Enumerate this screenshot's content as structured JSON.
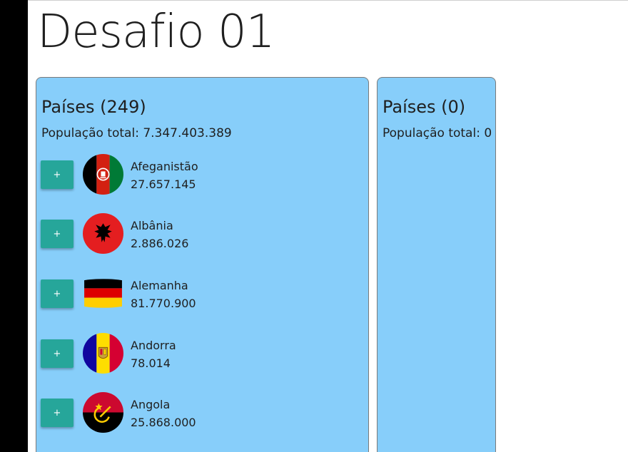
{
  "page": {
    "title": "Desafio 01"
  },
  "panel_all": {
    "title": "Países (249)",
    "population": "População total: 7.347.403.389"
  },
  "panel_selected": {
    "title": "Países (0)",
    "population": "População total: 0"
  },
  "add_button_label": "+",
  "countries": [
    {
      "name": "Afeganistão",
      "population": "27.657.145",
      "flag": "afghanistan-flag"
    },
    {
      "name": "Albânia",
      "population": "2.886.026",
      "flag": "albania-flag"
    },
    {
      "name": "Alemanha",
      "population": "81.770.900",
      "flag": "germany-flag"
    },
    {
      "name": "Andorra",
      "population": "78.014",
      "flag": "andorra-flag"
    },
    {
      "name": "Angola",
      "population": "25.868.000",
      "flag": "angola-flag"
    }
  ],
  "colors": {
    "panel_bg": "#87cefa",
    "button_bg": "#26a69a",
    "left_bar": "#000000"
  }
}
